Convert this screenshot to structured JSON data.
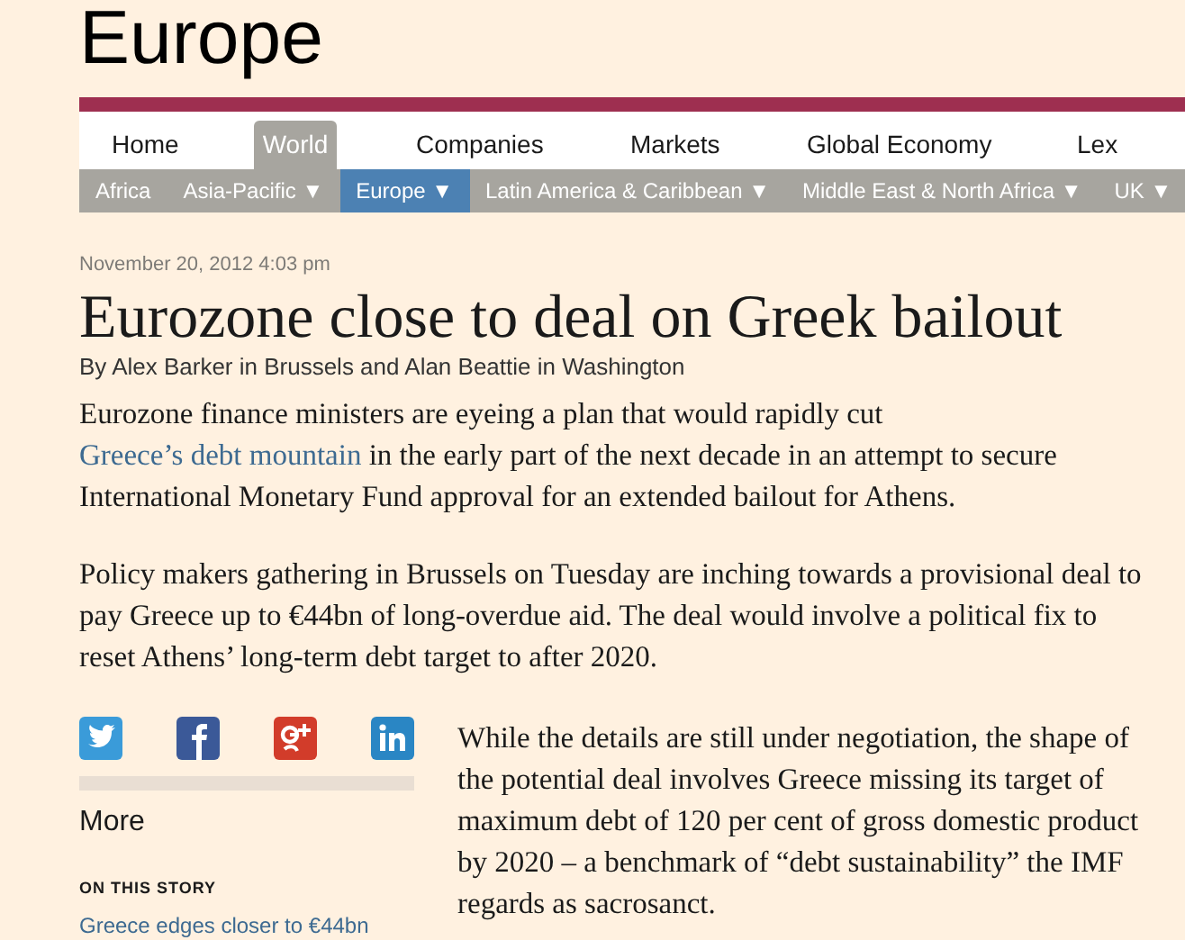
{
  "section_title": "Europe",
  "nav": [
    {
      "label": "Home",
      "selected": false
    },
    {
      "label": "World",
      "selected": true
    },
    {
      "label": "Companies",
      "selected": false
    },
    {
      "label": "Markets",
      "selected": false
    },
    {
      "label": "Global Economy",
      "selected": false
    },
    {
      "label": "Lex",
      "selected": false
    }
  ],
  "subnav": [
    {
      "label": "Africa",
      "selected": false
    },
    {
      "label": "Asia-Pacific ▼",
      "selected": false
    },
    {
      "label": "Europe ▼",
      "selected": true
    },
    {
      "label": "Latin America & Caribbean ▼",
      "selected": false
    },
    {
      "label": "Middle East & North Africa ▼",
      "selected": false
    },
    {
      "label": "UK ▼",
      "selected": false
    }
  ],
  "article": {
    "date": "November 20, 2012 4:03 pm",
    "headline": "Eurozone close to deal on Greek bailout",
    "byline": "By Alex Barker in Brussels and Alan Beattie in Washington",
    "paragraphs": [
      {
        "before": "Eurozone finance ministers are eyeing a plan that would rapidly cut ",
        "link": "Greece’s debt mountain",
        "after": " in the early part of the next decade in an attempt to secure International Monetary Fund approval for an extended bailout for Athens."
      },
      {
        "before": "Policy makers gathering in Brussels on Tuesday are inching towards a provisional deal to pay Greece up to €44bn of long-overdue aid. The deal would involve a political fix to reset Athens’ long-term debt target to after 2020."
      }
    ],
    "side_paragraph": "While the details are still under negotiation, the shape of the potential deal involves Greece missing its target of maximum debt of 120 per cent of gross domestic product by 2020 – a benchmark of “debt sustainability” the IMF regards as sacrosanct."
  },
  "share": {
    "services": [
      {
        "kind": "twitter"
      },
      {
        "kind": "facebook"
      },
      {
        "kind": "googleplus"
      },
      {
        "kind": "linkedin"
      }
    ],
    "more": "More"
  },
  "on_this_story": {
    "heading": "ON THIS STORY",
    "links": [
      "Greece edges closer to €44bn"
    ]
  }
}
